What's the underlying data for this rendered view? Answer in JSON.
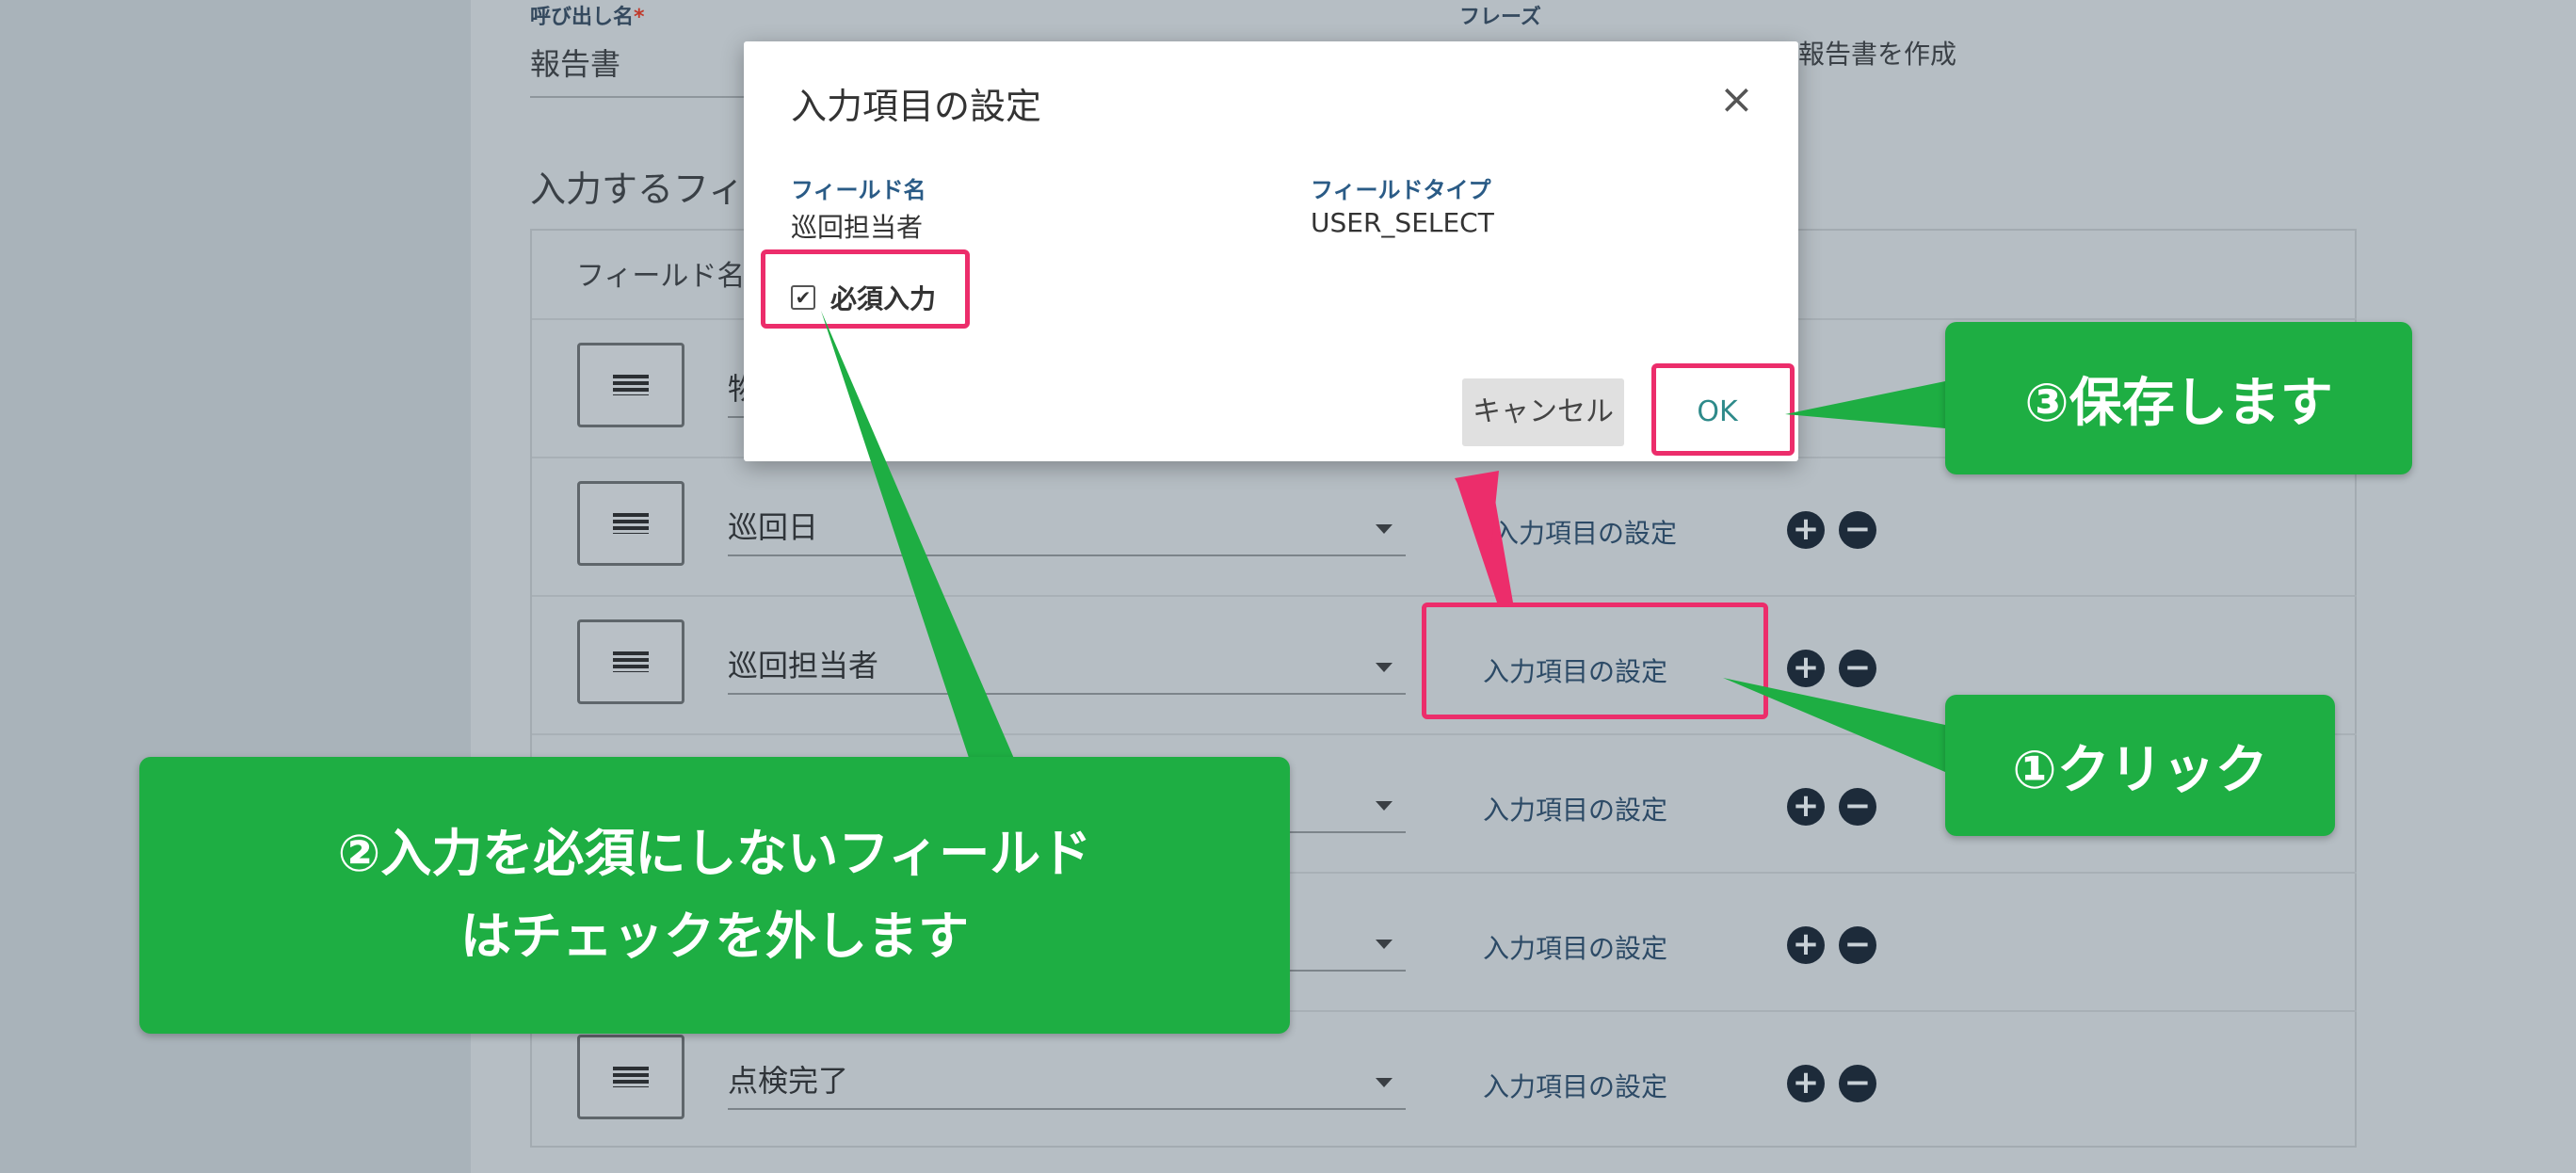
{
  "background_form": {
    "call_name_label": "呼び出し名",
    "required_mark": "*",
    "call_name_value": "報告書",
    "phrase_label": "フレーズ",
    "phrase_value": "報告書を作成",
    "fields_heading": "入力するフィ",
    "fields_col_header": "フィールド名",
    "rows": [
      {
        "name": "物",
        "setting": ""
      },
      {
        "name": "巡回日",
        "setting": "入力項目の設定"
      },
      {
        "name": "巡回担当者",
        "setting": "入力項目の設定"
      },
      {
        "name": "",
        "setting": "入力項目の設定"
      },
      {
        "name": "",
        "setting": "入力項目の設定"
      },
      {
        "name": "点検完了",
        "setting": "入力項目の設定"
      }
    ],
    "plus_symbol": "+",
    "minus_symbol": "−"
  },
  "modal": {
    "title": "入力項目の設定",
    "close_symbol": "×",
    "field_name_label": "フィールド名",
    "field_name_value": "巡回担当者",
    "field_type_label": "フィールドタイプ",
    "field_type_value": "USER_SELECT",
    "required_checkbox_label": "必須入力",
    "required_checked": true,
    "cancel_label": "キャンセル",
    "ok_label": "OK"
  },
  "annotations": {
    "callout_1": "①クリック",
    "callout_2_line1": "②入力を必須にしないフィールド",
    "callout_2_line2": "はチェックを外します",
    "callout_3": "③保存します"
  },
  "colors": {
    "callout_green": "#1eae43",
    "highlight_pink": "#ec2d6b",
    "modal_label_blue": "#2a5b86",
    "ok_text": "#2e8a8a"
  }
}
